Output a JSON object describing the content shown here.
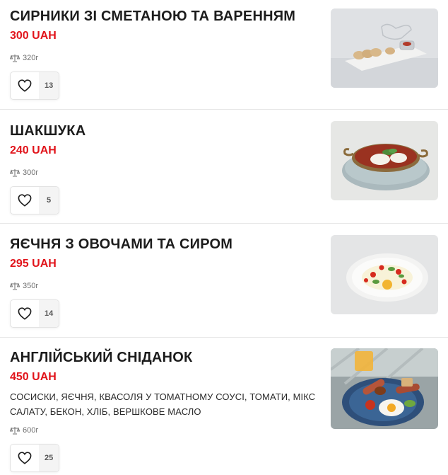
{
  "menu": {
    "items": [
      {
        "title": "СИРНИКИ ЗІ СМЕТАНОЮ ТА ВАРЕННЯМ",
        "price": "300 UAH",
        "weight": "320г",
        "likes": "13",
        "photo_icon": "syrniki-photo"
      },
      {
        "title": "ШАКШУКА",
        "price": "240 UAH",
        "weight": "300г",
        "likes": "5",
        "photo_icon": "shakshuka-photo"
      },
      {
        "title": "ЯЄЧНЯ З ОВОЧАМИ ТА СИРОМ",
        "price": "295 UAH",
        "weight": "350г",
        "likes": "14",
        "photo_icon": "omelette-photo"
      },
      {
        "title": "АНГЛІЙСЬКИЙ СНІДАНОК",
        "price": "450 UAH",
        "description": "СОСИСКИ, ЯЄЧНЯ, КВАСОЛЯ У ТОМАТНОМУ СОУСІ, ТОМАТИ, МІКС САЛАТУ, БЕКОН, ХЛІБ, ВЕРШКОВЕ МАСЛО",
        "weight": "600г",
        "likes": "25",
        "photo_icon": "english-breakfast-photo"
      }
    ]
  },
  "colors": {
    "price": "#e1141b",
    "title": "#1c1c1c",
    "divider": "#e6e6e6"
  },
  "icons": {
    "weight": "scale-icon",
    "like": "heart-icon"
  }
}
